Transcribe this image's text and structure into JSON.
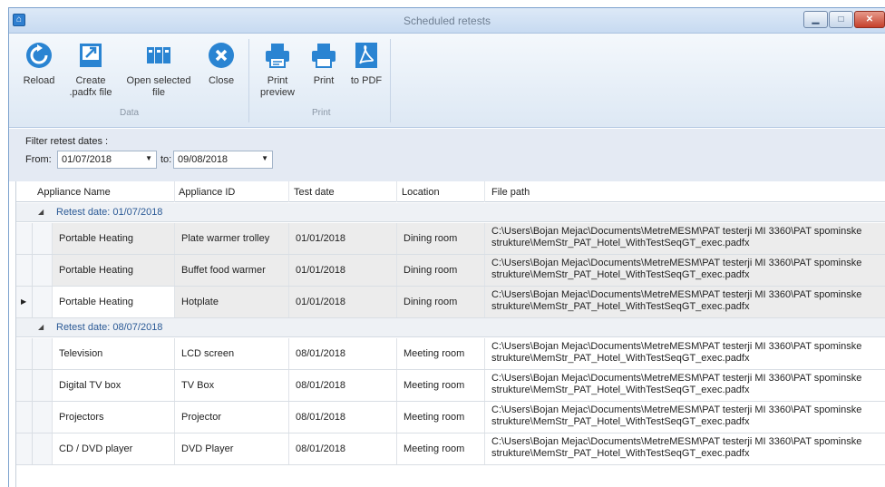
{
  "window": {
    "title": "Scheduled retests",
    "icon": "app-icon"
  },
  "ribbon": {
    "buttons": [
      {
        "label": "Reload",
        "icon": "reload-icon"
      },
      {
        "label": "Create\n.padfx file",
        "icon": "export-icon"
      },
      {
        "label": "Open selected\nfile",
        "icon": "open-file-icon"
      },
      {
        "label": "Close",
        "icon": "close-circle-icon"
      },
      {
        "label": "Print\npreview",
        "icon": "print-preview-icon"
      },
      {
        "label": "Print",
        "icon": "printer-icon"
      },
      {
        "label": "to PDF",
        "icon": "pdf-icon"
      }
    ],
    "groups": {
      "data": "Data",
      "print": "Print"
    }
  },
  "filter": {
    "title": "Filter retest dates :",
    "from_label": "From:",
    "from_value": "01/07/2018",
    "to_label": "to:",
    "to_value": "09/08/2018"
  },
  "grid": {
    "columns": [
      "Appliance Name",
      "Appliance ID",
      "Test date",
      "Location",
      "File path"
    ],
    "groups": [
      {
        "label": "Retest date: 01/07/2018",
        "rows": [
          {
            "name": "Portable Heating",
            "id": "Plate warmer trolley",
            "date": "01/01/2018",
            "location": "Dining room",
            "path": "C:\\Users\\Bojan Mejac\\Documents\\MetreMESM\\PAT testerji MI 3360\\PAT spominske strukture\\MemStr_PAT_Hotel_WithTestSeqGT_exec.padfx"
          },
          {
            "name": "Portable Heating",
            "id": "Buffet food warmer",
            "date": "01/01/2018",
            "location": "Dining room",
            "path": "C:\\Users\\Bojan Mejac\\Documents\\MetreMESM\\PAT testerji MI 3360\\PAT spominske strukture\\MemStr_PAT_Hotel_WithTestSeqGT_exec.padfx"
          },
          {
            "name": "Portable Heating",
            "id": "Hotplate",
            "date": "01/01/2018",
            "location": "Dining room",
            "path": "C:\\Users\\Bojan Mejac\\Documents\\MetreMESM\\PAT testerji MI 3360\\PAT spominske strukture\\MemStr_PAT_Hotel_WithTestSeqGT_exec.padfx"
          }
        ]
      },
      {
        "label": "Retest date: 08/07/2018",
        "rows": [
          {
            "name": "Television",
            "id": "LCD screen",
            "date": "08/01/2018",
            "location": "Meeting room",
            "path": "C:\\Users\\Bojan Mejac\\Documents\\MetreMESM\\PAT testerji MI 3360\\PAT spominske strukture\\MemStr_PAT_Hotel_WithTestSeqGT_exec.padfx"
          },
          {
            "name": "Digital TV box",
            "id": "TV Box",
            "date": "08/01/2018",
            "location": "Meeting room",
            "path": "C:\\Users\\Bojan Mejac\\Documents\\MetreMESM\\PAT testerji MI 3360\\PAT spominske strukture\\MemStr_PAT_Hotel_WithTestSeqGT_exec.padfx"
          },
          {
            "name": "Projectors",
            "id": "Projector",
            "date": "08/01/2018",
            "location": "Meeting room",
            "path": "C:\\Users\\Bojan Mejac\\Documents\\MetreMESM\\PAT testerji MI 3360\\PAT spominske strukture\\MemStr_PAT_Hotel_WithTestSeqGT_exec.padfx"
          },
          {
            "name": "CD / DVD player",
            "id": "DVD Player",
            "date": "08/01/2018",
            "location": "Meeting room",
            "path": "C:\\Users\\Bojan Mejac\\Documents\\MetreMESM\\PAT testerji MI 3360\\PAT spominske strukture\\MemStr_PAT_Hotel_WithTestSeqGT_exec.padfx"
          }
        ]
      }
    ]
  },
  "colors": {
    "accent": "#2a84d2",
    "pdf": "#c0392b",
    "group_text": "#2b5a96"
  }
}
